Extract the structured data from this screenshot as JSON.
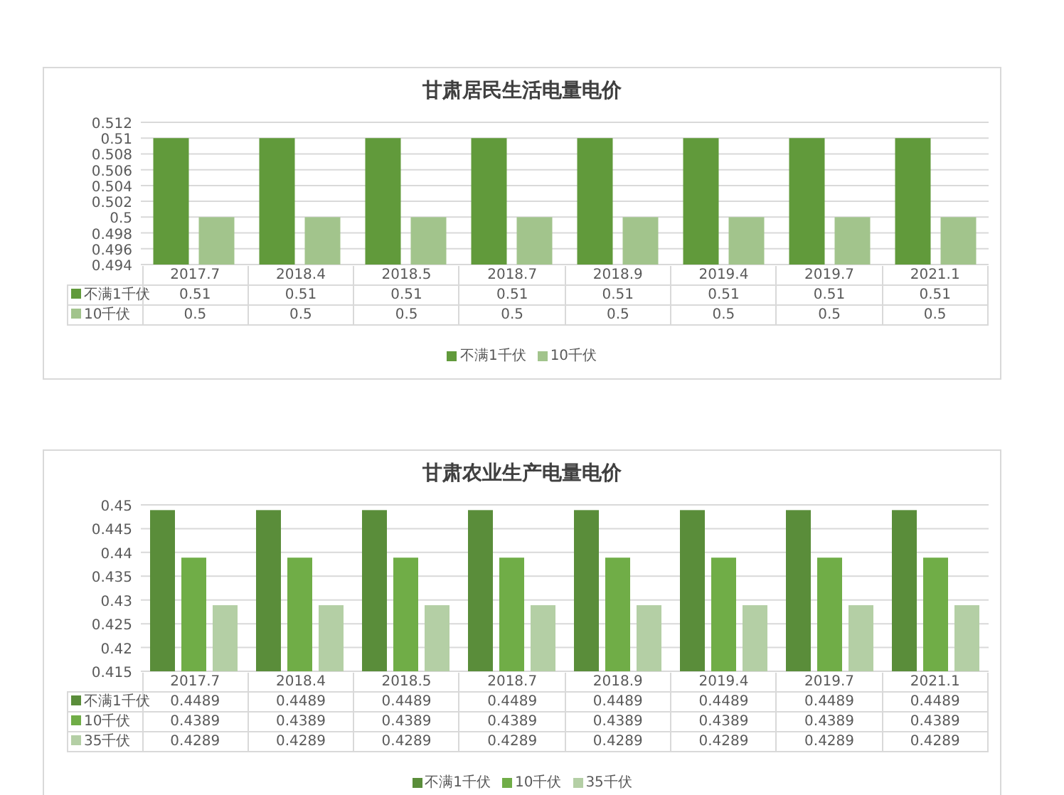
{
  "charts": [
    {
      "chart_data": {
        "type": "bar",
        "title": "甘肃居民生活电量电价",
        "categories": [
          "2017.7",
          "2018.4",
          "2018.5",
          "2018.7",
          "2018.9",
          "2019.4",
          "2019.7",
          "2021.1"
        ],
        "series": [
          {
            "name": "不满1千伏",
            "color": "#619a3b",
            "values": [
              0.51,
              0.51,
              0.51,
              0.51,
              0.51,
              0.51,
              0.51,
              0.51
            ]
          },
          {
            "name": "10千伏",
            "color": "#a2c48c",
            "values": [
              0.5,
              0.5,
              0.5,
              0.5,
              0.5,
              0.5,
              0.5,
              0.5
            ]
          }
        ],
        "grid": true,
        "legend": true,
        "data_labels": true,
        "ylim": [
          0.494,
          0.512
        ],
        "yticks": [
          0.494,
          0.496,
          0.498,
          0.5,
          0.502,
          0.504,
          0.506,
          0.508,
          0.51,
          0.512
        ]
      }
    },
    {
      "chart_data": {
        "type": "bar",
        "title": "甘肃农业生产电量电价",
        "categories": [
          "2017.7",
          "2018.4",
          "2018.5",
          "2018.7",
          "2018.9",
          "2019.4",
          "2019.7",
          "2021.1"
        ],
        "series": [
          {
            "name": "不满1千伏",
            "color": "#5a8d3a",
            "values": [
              0.4489,
              0.4489,
              0.4489,
              0.4489,
              0.4489,
              0.4489,
              0.4489,
              0.4489
            ]
          },
          {
            "name": "10千伏",
            "color": "#70ad47",
            "values": [
              0.4389,
              0.4389,
              0.4389,
              0.4389,
              0.4389,
              0.4389,
              0.4389,
              0.4389
            ]
          },
          {
            "name": "35千伏",
            "color": "#b4cfa5",
            "values": [
              0.4289,
              0.4289,
              0.4289,
              0.4289,
              0.4289,
              0.4289,
              0.4289,
              0.4289
            ]
          }
        ],
        "grid": true,
        "legend": true,
        "data_labels": true,
        "ylim": [
          0.415,
          0.45
        ],
        "yticks": [
          0.415,
          0.42,
          0.425,
          0.43,
          0.435,
          0.44,
          0.445,
          0.45
        ]
      }
    }
  ]
}
